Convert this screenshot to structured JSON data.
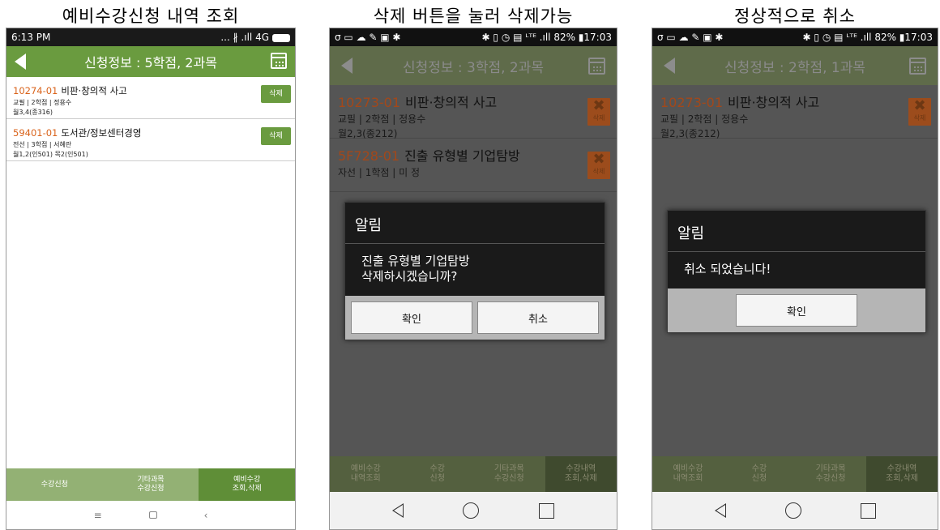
{
  "captions": [
    "예비수강신청 내역 조회",
    "삭제 버튼을 눌러 삭제가능",
    "정상적으로 취소"
  ],
  "p1": {
    "status_time": "6:13 PM",
    "status_right": "... ∦ .ıll 4G",
    "title": "신청정보 : 5학점, 2과목",
    "rows": [
      {
        "code": "10274-01",
        "name": "비판·창의적 사고",
        "meta1": "교필 | 2학점 | 정용수",
        "meta2": "월3,4(종316)",
        "delete": "삭제"
      },
      {
        "code": "59401-01",
        "name": "도서관/정보센터경영",
        "meta1": "전선 | 3학점 | 서혜란",
        "meta2": "월1,2(인501) 목2(인501)",
        "delete": "삭제"
      }
    ],
    "tabs": [
      "수강신청",
      "기타과목\n수강신청",
      "예비수강\n조회,삭제"
    ],
    "nav": [
      "≡",
      "‹"
    ]
  },
  "p2": {
    "status_left": "σ ▭ ☁ ✎ ▣ ✱",
    "status_right": "✱ ▯ ◷ ▤ ᴸᵀᴱ .ıll 82% ▮17:03",
    "title": "신청정보 : 3학점, 2과목",
    "rows": [
      {
        "code": "10273-01",
        "name": "비판·창의적 사고",
        "meta1": "교필 | 2학점 | 정용수",
        "meta2": "월2,3(종212)",
        "x": "✖",
        "delete": "삭제"
      },
      {
        "code": "5F728-01",
        "name": "진출 유형별 기업탐방",
        "meta1": "자선 | 1학점 | 미 정",
        "meta2": "",
        "x": "✖",
        "delete": "삭제"
      }
    ],
    "tabs": [
      "예비수강\n내역조회",
      "수강\n신청",
      "기타과목\n수강신청",
      "수강내역\n조회,삭제"
    ],
    "dialog": {
      "title": "알림",
      "message": "진출 유형별 기업탐방\n삭제하시겠습니까?",
      "ok": "확인",
      "cancel": "취소"
    }
  },
  "p3": {
    "status_left": "σ ▭ ☁ ✎ ▣ ✱",
    "status_right": "✱ ▯ ◷ ▤ ᴸᵀᴱ .ıll 82% ▮17:03",
    "title": "신청정보 : 2학점, 1과목",
    "rows": [
      {
        "code": "10273-01",
        "name": "비판·창의적 사고",
        "meta1": "교필 | 2학점 | 정용수",
        "meta2": "월2,3(종212)",
        "x": "✖",
        "delete": "삭제"
      }
    ],
    "tabs": [
      "예비수강\n내역조회",
      "수강\n신청",
      "기타과목\n수강신청",
      "수강내역\n조회,삭제"
    ],
    "dialog": {
      "title": "알림",
      "message": "취소 되었습니다!",
      "ok": "확인"
    }
  }
}
